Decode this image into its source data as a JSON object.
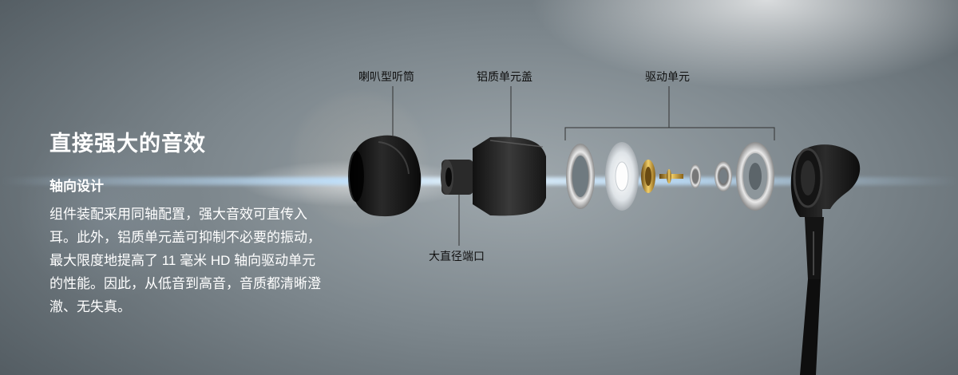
{
  "heading": {
    "title": "直接强大的音效",
    "subtitle": "轴向设计",
    "body": "组件装配采用同轴配置，强大音效可直传入耳。此外，铝质单元盖可抑制不必要的振动，最大限度地提高了 11 毫米 HD 轴向驱动单元的性能。因此，从低音到高音，音质都清晰澄澈、无失真。"
  },
  "labels": {
    "eartip": "喇叭型听筒",
    "aluminum_cap": "铝质单元盖",
    "driver_unit": "驱动单元",
    "port": "大直径端口"
  }
}
